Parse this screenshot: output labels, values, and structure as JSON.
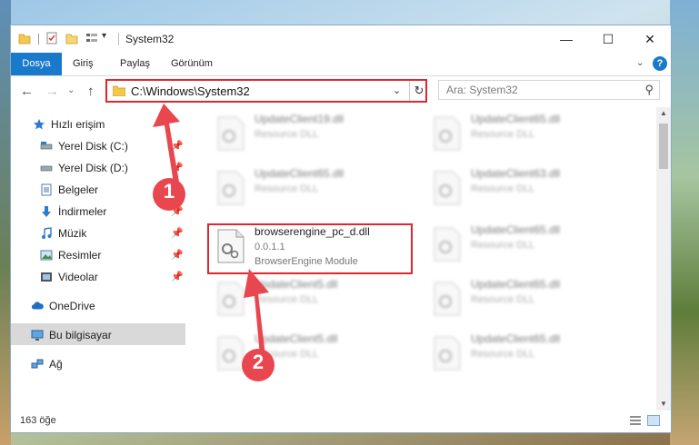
{
  "window": {
    "title": "System32",
    "controls": {
      "minimize": "—",
      "maximize": "☐",
      "close": "✕"
    }
  },
  "ribbon": {
    "tabs": [
      "Dosya",
      "Giriş",
      "Paylaş",
      "Görünüm"
    ],
    "help": "?"
  },
  "address": {
    "path": "C:\\Windows\\System32",
    "search_placeholder": "Ara: System32"
  },
  "sidebar": {
    "items": [
      {
        "label": "Hızlı erişim",
        "icon": "star-icon"
      },
      {
        "label": "Yerel Disk (C:)",
        "icon": "drive-icon",
        "pinned": true
      },
      {
        "label": "Yerel Disk (D:)",
        "icon": "drive-icon",
        "pinned": true
      },
      {
        "label": "Belgeler",
        "icon": "document-icon",
        "pinned": true
      },
      {
        "label": "İndirmeler",
        "icon": "download-icon",
        "pinned": true
      },
      {
        "label": "Müzik",
        "icon": "music-icon",
        "pinned": true
      },
      {
        "label": "Resimler",
        "icon": "pictures-icon",
        "pinned": true
      },
      {
        "label": "Videolar",
        "icon": "videos-icon",
        "pinned": true
      },
      {
        "label": "OneDrive",
        "icon": "cloud-icon"
      },
      {
        "label": "Bu bilgisayar",
        "icon": "computer-icon",
        "selected": true
      },
      {
        "label": "Ağ",
        "icon": "network-icon"
      }
    ]
  },
  "files": {
    "highlighted": {
      "name": "browserengine_pc_d.dll",
      "version": "0.0.1.1",
      "description": "BrowserEngine Module"
    },
    "blurred": [
      {
        "name": "UpdateClient19.dll",
        "type": "Resource DLL"
      },
      {
        "name": "UpdateClient65.dll",
        "type": "Resource DLL"
      },
      {
        "name": "UpdateClient65.dll",
        "type": "Resource DLL"
      },
      {
        "name": "UpdateClient63.dll",
        "type": "Resource DLL"
      },
      {
        "name": "UpdateClient65.dll",
        "type": "Resource DLL"
      },
      {
        "name": "UpdateClient5.dll",
        "type": "Resource DLL"
      },
      {
        "name": "UpdateClient65.dll",
        "type": "Resource DLL"
      },
      {
        "name": "UpdateClient5.dll",
        "type": "Resource DLL"
      },
      {
        "name": "UpdateClient65.dll",
        "type": "Resource DLL"
      }
    ]
  },
  "status": {
    "count": "163 öğe"
  },
  "callouts": [
    "1",
    "2"
  ],
  "colors": {
    "accent": "#1979ca",
    "highlight": "#e0262e",
    "arrow": "#e8474f"
  }
}
